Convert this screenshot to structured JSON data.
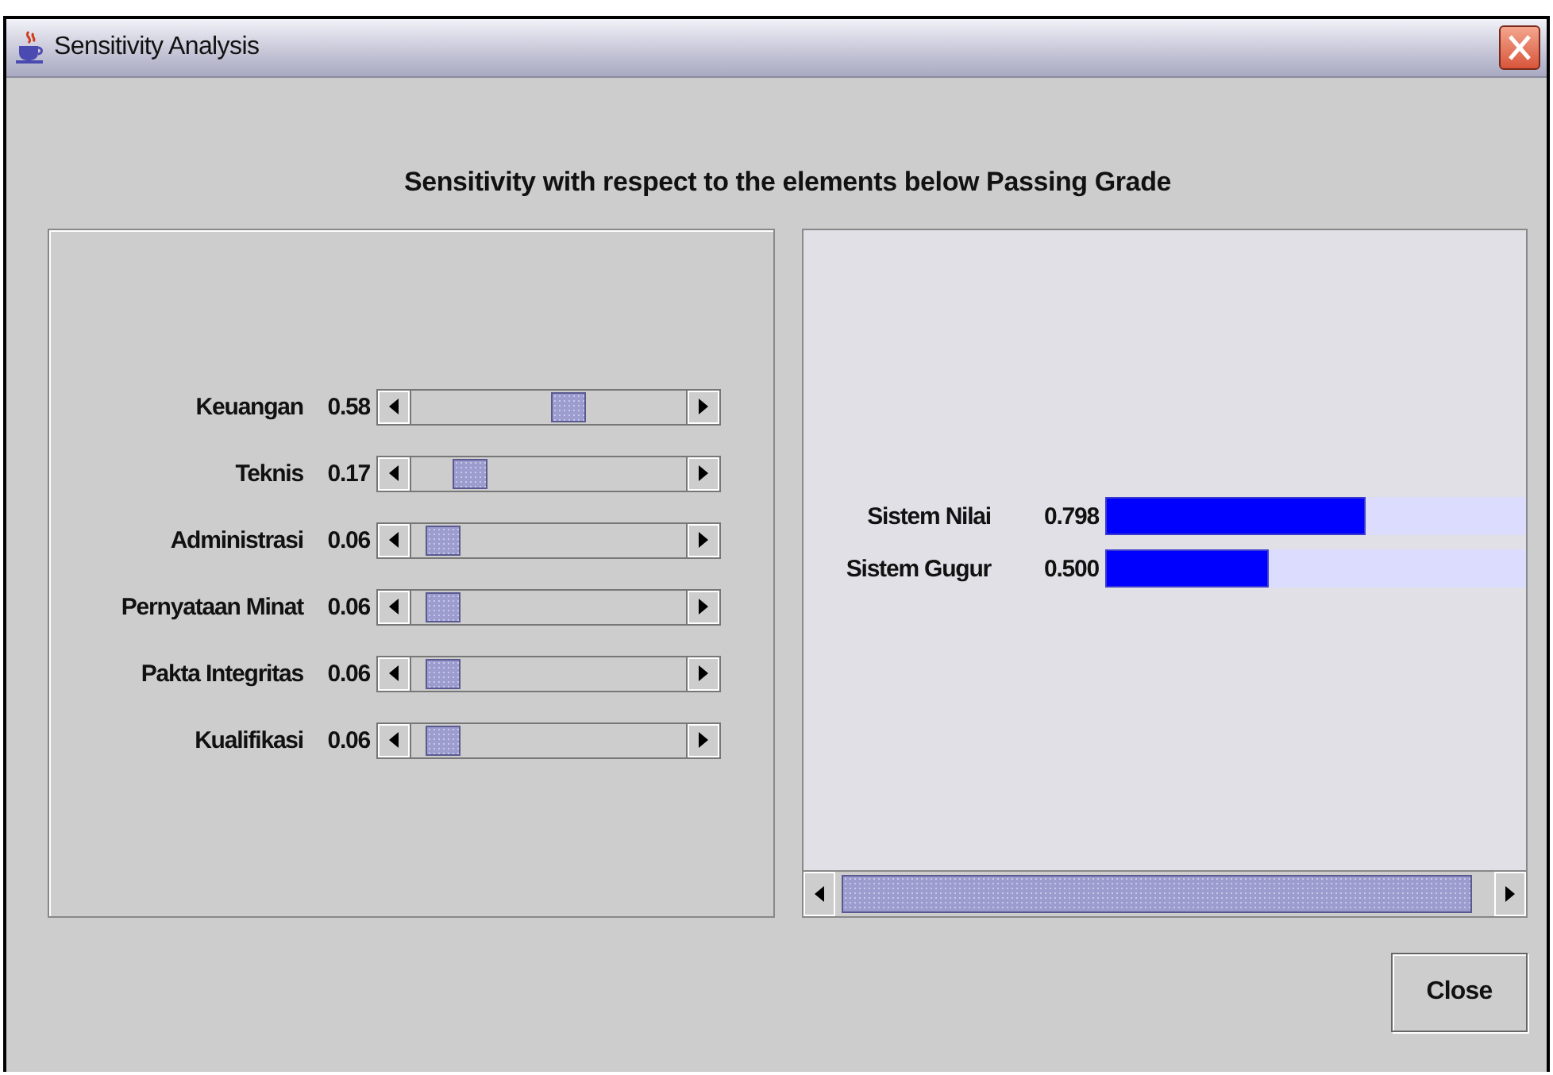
{
  "window": {
    "title": "Sensitivity Analysis"
  },
  "heading": "Sensitivity with respect to the elements below Passing Grade",
  "sliders": [
    {
      "label": "Keuangan",
      "value": "0.58",
      "level": 0.58
    },
    {
      "label": "Teknis",
      "value": "0.17",
      "level": 0.17
    },
    {
      "label": "Administrasi",
      "value": "0.06",
      "level": 0.06
    },
    {
      "label": "Pernyataan Minat",
      "value": "0.06",
      "level": 0.06
    },
    {
      "label": "Pakta Integritas",
      "value": "0.06",
      "level": 0.06
    },
    {
      "label": "Kualifikasi",
      "value": "0.06",
      "level": 0.06
    }
  ],
  "results": [
    {
      "label": "Sistem Nilai",
      "value": "0.798",
      "level": 0.62
    },
    {
      "label": "Sistem Gugur",
      "value": "0.500",
      "level": 0.39
    }
  ],
  "buttons": [
    "Close"
  ]
}
